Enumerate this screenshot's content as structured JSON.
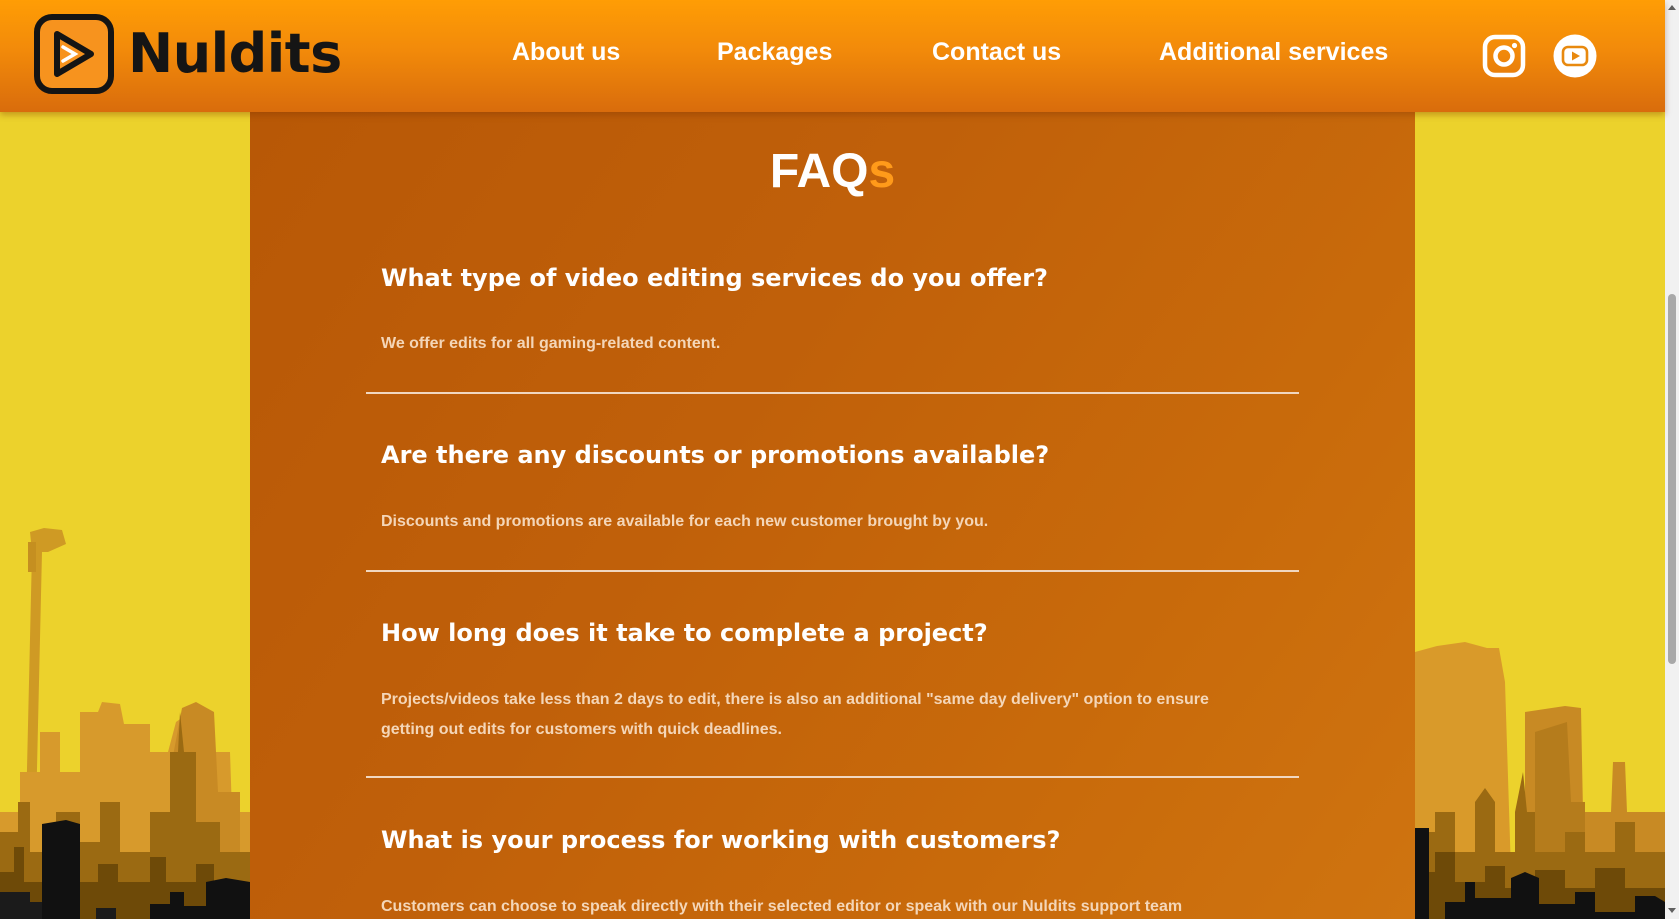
{
  "brand": {
    "name": "Nuldits",
    "logo_icon": "play-icon"
  },
  "nav": {
    "items": [
      {
        "label": "About us"
      },
      {
        "label": "Packages"
      },
      {
        "label": "Contact us"
      },
      {
        "label": "Additional services"
      }
    ]
  },
  "social": [
    {
      "icon": "instagram-icon"
    },
    {
      "icon": "youtube-icon"
    }
  ],
  "faq": {
    "title_main": "FAQ",
    "title_accent": "s",
    "items": [
      {
        "question": "What type of video editing services do you offer?",
        "answer": "We offer edits for all gaming-related content."
      },
      {
        "question": "Are there any discounts or promotions available?",
        "answer": "Discounts and promotions are available for each new customer brought by you."
      },
      {
        "question": "How long does it take to complete a project?",
        "answer": "Projects/videos take less than 2 days to edit, there is also an additional \"same day delivery\" option to ensure getting out edits for customers with quick deadlines."
      },
      {
        "question": "What is your process for working with customers?",
        "answer": "Customers can choose to speak directly with their selected editor or speak with our Nuldits support team"
      }
    ]
  },
  "colors": {
    "header": "#f7931e",
    "accent": "#ff9a1a",
    "panel": "#c0600a",
    "side_background": "#ecd22c"
  }
}
